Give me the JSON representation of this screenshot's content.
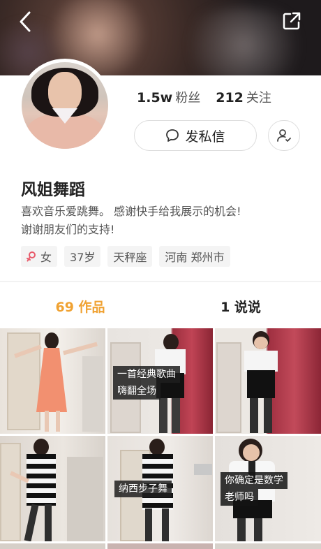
{
  "header": {
    "back_icon": "chevron-left-icon",
    "share_icon": "share-external-icon"
  },
  "profile": {
    "fans_count": "1.5w",
    "fans_label": "粉丝",
    "following_count": "212",
    "following_label": "关注",
    "message_button": "发私信",
    "name": "风姐舞蹈",
    "bio_line1": "喜欢音乐爱跳舞。 感谢快手给我展示的机会!",
    "bio_line2": "谢谢朋友们的支持!",
    "tags": {
      "gender": "女",
      "age": "37岁",
      "zodiac": "天秤座",
      "location": "河南 郑州市"
    }
  },
  "tabs": {
    "works": "69 作品",
    "posts": "1 说说"
  },
  "grid": {
    "captions": {
      "item2_line1": "一首经典歌曲",
      "item2_line2": "嗨翻全场",
      "item5": "纳西步子舞",
      "item6_line1": "你确定是数学",
      "item6_line2": "老师吗"
    }
  },
  "colors": {
    "accent": "#f0a232",
    "gender_icon": "#e85a6a"
  }
}
